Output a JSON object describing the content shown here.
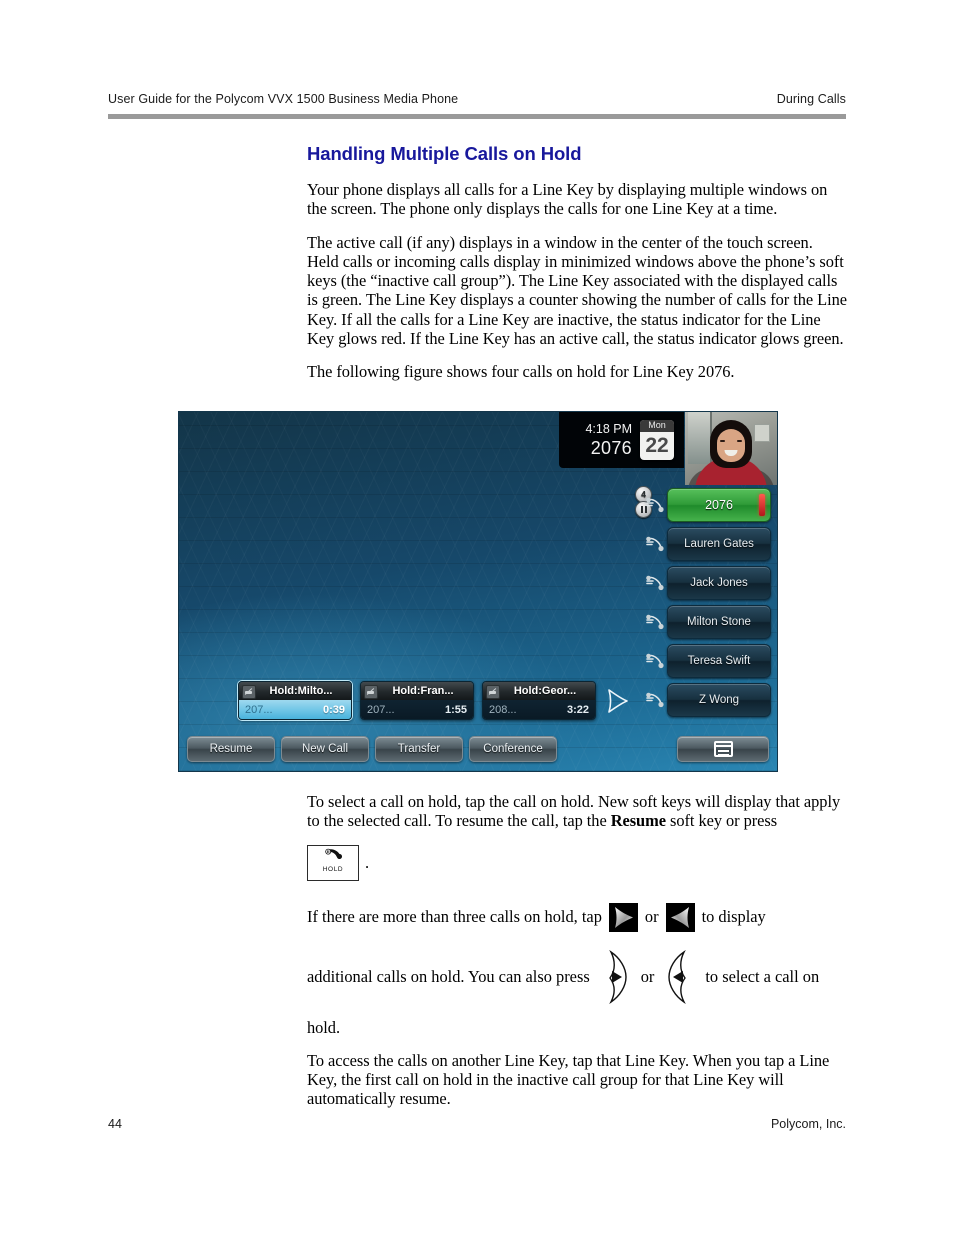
{
  "header": {
    "left": "User Guide for the Polycom VVX 1500 Business Media Phone",
    "right": "During Calls"
  },
  "section": {
    "title": "Handling Multiple Calls on Hold",
    "paragraph_1": "Your phone displays all calls for a Line Key by displaying multiple windows on the screen. The phone only displays the calls for one Line Key at a time.",
    "paragraph_2": "The active call (if any) displays in a window in the center of the touch screen. Held calls or incoming calls display in minimized windows above the phone’s soft keys (the “inactive call group”). The Line Key associated with the displayed calls is green. The Line Key displays a counter showing the number of calls for the Line Key. If all the calls for a Line Key are inactive, the status indicator for the Line Key glows red. If the Line Key has an active call, the status indicator glows green.",
    "paragraph_3": "The following figure shows four calls on hold for Line Key 2076.",
    "paragraph_4a": "To select a call on hold, tap the call on hold. New soft keys will display that apply to the selected call. To resume the call, tap the ",
    "paragraph_4b": "Resume",
    "paragraph_4c": " soft key or press",
    "paragraph_4_end": ".",
    "paragraph_5a": "If there are more than three calls on hold, tap",
    "paragraph_5b": "or",
    "paragraph_5c": "to display",
    "paragraph_6a": "additional calls on hold. You can also press",
    "paragraph_6b": "or",
    "paragraph_6c": "to select a call on",
    "paragraph_6d": "hold.",
    "paragraph_7": "To access the calls on another Line Key, tap that Line Key. When you tap a Line Key, the first call on hold in the inactive call group for that Line Key will automatically resume."
  },
  "phone": {
    "status": {
      "time": "4:18 PM",
      "extension": "2076",
      "calendar_weekday": "Mon",
      "calendar_day": "22"
    },
    "line_keys": [
      {
        "label": "2076",
        "state": "active",
        "call_count": "4",
        "hold_badge": true,
        "led": "red"
      },
      {
        "label": "Lauren Gates",
        "state": "idle"
      },
      {
        "label": "Jack Jones",
        "state": "idle"
      },
      {
        "label": "Milton Stone",
        "state": "idle"
      },
      {
        "label": "Teresa Swift",
        "state": "idle"
      },
      {
        "label": "Z Wong",
        "state": "idle"
      }
    ],
    "held_calls": [
      {
        "title": "Hold:Milto...",
        "number": "207...",
        "duration": "0:39",
        "selected": true
      },
      {
        "title": "Hold:Fran...",
        "number": "207...",
        "duration": "1:55",
        "selected": false
      },
      {
        "title": "Hold:Geor...",
        "number": "208...",
        "duration": "3:22",
        "selected": false
      }
    ],
    "soft_keys": [
      "Resume",
      "New Call",
      "Transfer",
      "Conference"
    ],
    "menu_key_icon": "menu-icon",
    "next_arrow_icon": "arrow-right-icon"
  },
  "hold_key": {
    "label": "HOLD"
  },
  "footer": {
    "page_number": "44",
    "company": "Polycom, Inc."
  },
  "colors": {
    "heading": "#18189c",
    "line_key_active": "#2f9b38",
    "led_red": "#b3161b",
    "selected_call": "#6fc5e6"
  }
}
